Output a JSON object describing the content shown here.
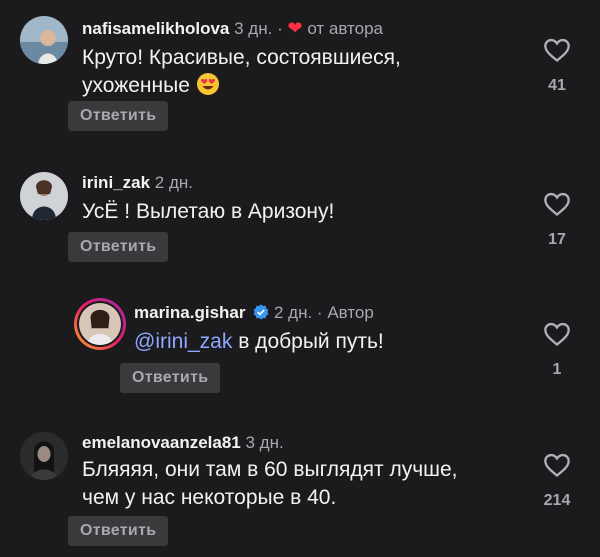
{
  "comments": [
    {
      "username": "nafisamelikholova",
      "time": "3 дн.",
      "separator": "·",
      "author_tag": "от автора",
      "author_tag_icon": "heart-icon",
      "text": "Круто! Красивые, состоявшиеся,",
      "text2": "ухоженные",
      "emoji": "heart-eyes-emoji",
      "reply_label": "Ответить",
      "likes": "41"
    },
    {
      "username": "irini_zak",
      "time": "2 дн.",
      "text": "УсЁ ! Вылетаю в Аризону!",
      "reply_label": "Ответить",
      "likes": "17"
    },
    {
      "username": "marina.gishar",
      "verified_icon": "verified-badge-icon",
      "time": "2 дн.",
      "separator": "·",
      "author_tag": "Автор",
      "mention": "@irini_zak",
      "text": " в добрый путь!",
      "reply_label": "Ответить",
      "likes": "1"
    },
    {
      "username": "emelanovaanzela81",
      "time": "3 дн.",
      "text": "Бляяяя, они там в 60 выглядят лучше,",
      "text2": "чем у нас некоторые в 40.",
      "reply_label": "Ответить",
      "likes": "214"
    }
  ],
  "colors": {
    "background": "#1b1b1d",
    "heart_accent": "#ff3040",
    "mention": "#8fa7ff",
    "verified": "#3897f0",
    "secondary_text": "#a8a8ad"
  }
}
